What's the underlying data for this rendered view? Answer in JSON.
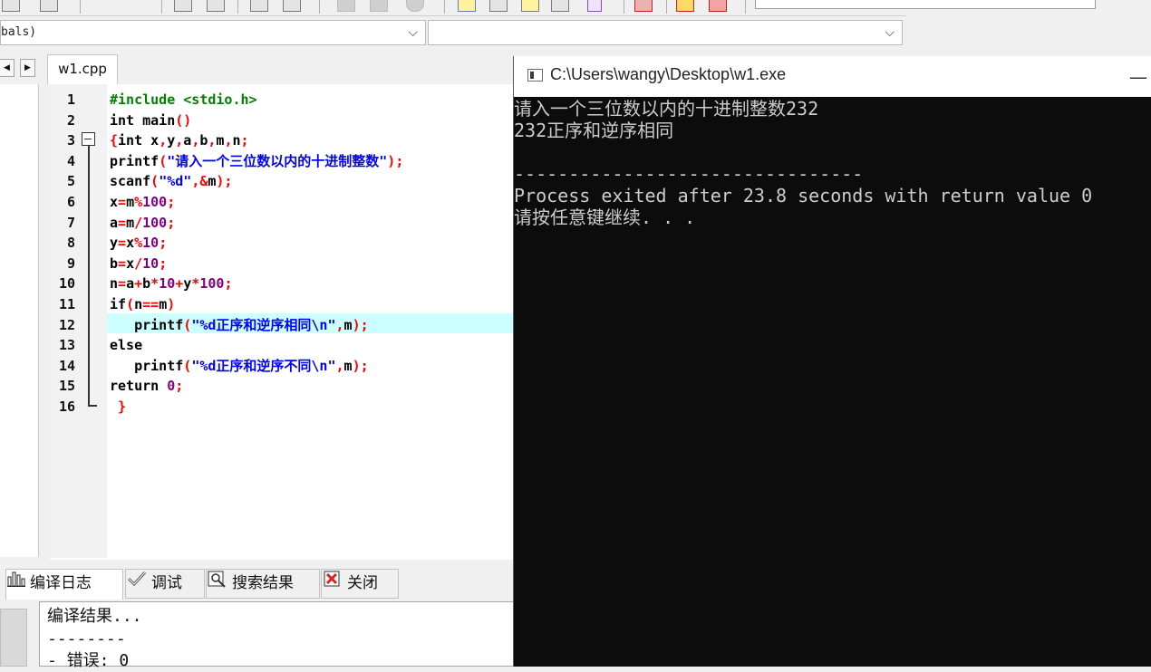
{
  "combo": {
    "scope_value": "bals)",
    "symbol_value": ""
  },
  "editor": {
    "tab_label": "w1.cpp",
    "line_numbers": [
      "1",
      "2",
      "3",
      "4",
      "5",
      "6",
      "7",
      "8",
      "9",
      "10",
      "11",
      "12",
      "13",
      "14",
      "15",
      "16"
    ],
    "lines": [
      [
        {
          "t": "pp",
          "v": "#include <stdio.h>"
        }
      ],
      [
        {
          "t": "kw",
          "v": "int"
        },
        {
          "t": "id",
          "v": " main"
        },
        {
          "t": "pu",
          "v": "()"
        }
      ],
      [
        {
          "t": "pu",
          "v": "{"
        },
        {
          "t": "kw",
          "v": "int"
        },
        {
          "t": "id",
          "v": " x"
        },
        {
          "t": "pu",
          "v": ","
        },
        {
          "t": "id",
          "v": "y"
        },
        {
          "t": "pu",
          "v": ","
        },
        {
          "t": "id",
          "v": "a"
        },
        {
          "t": "pu",
          "v": ","
        },
        {
          "t": "id",
          "v": "b"
        },
        {
          "t": "pu",
          "v": ","
        },
        {
          "t": "id",
          "v": "m"
        },
        {
          "t": "pu",
          "v": ","
        },
        {
          "t": "id",
          "v": "n"
        },
        {
          "t": "pu",
          "v": ";"
        }
      ],
      [
        {
          "t": "id",
          "v": "printf"
        },
        {
          "t": "pu",
          "v": "("
        },
        {
          "t": "st",
          "v": "\"请入一个三位数以内的十进制整数\""
        },
        {
          "t": "pu",
          "v": ");"
        }
      ],
      [
        {
          "t": "id",
          "v": "scanf"
        },
        {
          "t": "pu",
          "v": "("
        },
        {
          "t": "st",
          "v": "\"%d\""
        },
        {
          "t": "pu",
          "v": ",&"
        },
        {
          "t": "id",
          "v": "m"
        },
        {
          "t": "pu",
          "v": ");"
        }
      ],
      [
        {
          "t": "id",
          "v": "x"
        },
        {
          "t": "pu",
          "v": "="
        },
        {
          "t": "id",
          "v": "m"
        },
        {
          "t": "pu",
          "v": "%"
        },
        {
          "t": "nm",
          "v": "100"
        },
        {
          "t": "pu",
          "v": ";"
        }
      ],
      [
        {
          "t": "id",
          "v": "a"
        },
        {
          "t": "pu",
          "v": "="
        },
        {
          "t": "id",
          "v": "m"
        },
        {
          "t": "pu",
          "v": "/"
        },
        {
          "t": "nm",
          "v": "100"
        },
        {
          "t": "pu",
          "v": ";"
        }
      ],
      [
        {
          "t": "id",
          "v": "y"
        },
        {
          "t": "pu",
          "v": "="
        },
        {
          "t": "id",
          "v": "x"
        },
        {
          "t": "pu",
          "v": "%"
        },
        {
          "t": "nm",
          "v": "10"
        },
        {
          "t": "pu",
          "v": ";"
        }
      ],
      [
        {
          "t": "id",
          "v": "b"
        },
        {
          "t": "pu",
          "v": "="
        },
        {
          "t": "id",
          "v": "x"
        },
        {
          "t": "pu",
          "v": "/"
        },
        {
          "t": "nm",
          "v": "10"
        },
        {
          "t": "pu",
          "v": ";"
        }
      ],
      [
        {
          "t": "id",
          "v": "n"
        },
        {
          "t": "pu",
          "v": "="
        },
        {
          "t": "id",
          "v": "a"
        },
        {
          "t": "pu",
          "v": "+"
        },
        {
          "t": "id",
          "v": "b"
        },
        {
          "t": "pu",
          "v": "*"
        },
        {
          "t": "nm",
          "v": "10"
        },
        {
          "t": "pu",
          "v": "+"
        },
        {
          "t": "id",
          "v": "y"
        },
        {
          "t": "pu",
          "v": "*"
        },
        {
          "t": "nm",
          "v": "100"
        },
        {
          "t": "pu",
          "v": ";"
        }
      ],
      [
        {
          "t": "kw",
          "v": "if"
        },
        {
          "t": "pu",
          "v": "("
        },
        {
          "t": "id",
          "v": "n"
        },
        {
          "t": "pu",
          "v": "=="
        },
        {
          "t": "id",
          "v": "m"
        },
        {
          "t": "pu",
          "v": ")"
        }
      ],
      [
        {
          "t": "id",
          "v": "   printf"
        },
        {
          "t": "pu",
          "v": "("
        },
        {
          "t": "st",
          "v": "\"%d正序和逆序相同\\n\""
        },
        {
          "t": "pu",
          "v": ","
        },
        {
          "t": "id",
          "v": "m"
        },
        {
          "t": "pu",
          "v": ");"
        }
      ],
      [
        {
          "t": "kw",
          "v": "else"
        }
      ],
      [
        {
          "t": "id",
          "v": "   printf"
        },
        {
          "t": "pu",
          "v": "("
        },
        {
          "t": "st",
          "v": "\"%d正序和逆序不同\\n\""
        },
        {
          "t": "pu",
          "v": ","
        },
        {
          "t": "id",
          "v": "m"
        },
        {
          "t": "pu",
          "v": ");"
        }
      ],
      [
        {
          "t": "kw",
          "v": "return"
        },
        {
          "t": "id",
          "v": " "
        },
        {
          "t": "nm",
          "v": "0"
        },
        {
          "t": "pu",
          "v": ";"
        }
      ],
      [
        {
          "t": "id",
          "v": " "
        },
        {
          "t": "pu",
          "v": "}"
        }
      ]
    ]
  },
  "bottom_tabs": {
    "compile_log": "编译日志",
    "debug": "调试",
    "search_results": "搜索结果",
    "close": "关闭"
  },
  "log": {
    "lines": [
      "编译结果...",
      "--------",
      "- 错误: 0"
    ]
  },
  "console": {
    "title": "C:\\Users\\wangy\\Desktop\\w1.exe",
    "lines": [
      "请入一个三位数以内的十进制整数232",
      "232正序和逆序相同",
      "",
      "--------------------------------",
      "Process exited after 23.8 seconds with return value 0",
      "请按任意键继续. . ."
    ]
  },
  "colors": {
    "highlight_row": "#ccffff",
    "keyword": "#000000",
    "preprocessor": "#008000",
    "punctuation": "#ff0000",
    "string": "#0000ff",
    "number": "#800080",
    "console_bg": "#0c0c0c",
    "console_text": "#cccccc"
  }
}
